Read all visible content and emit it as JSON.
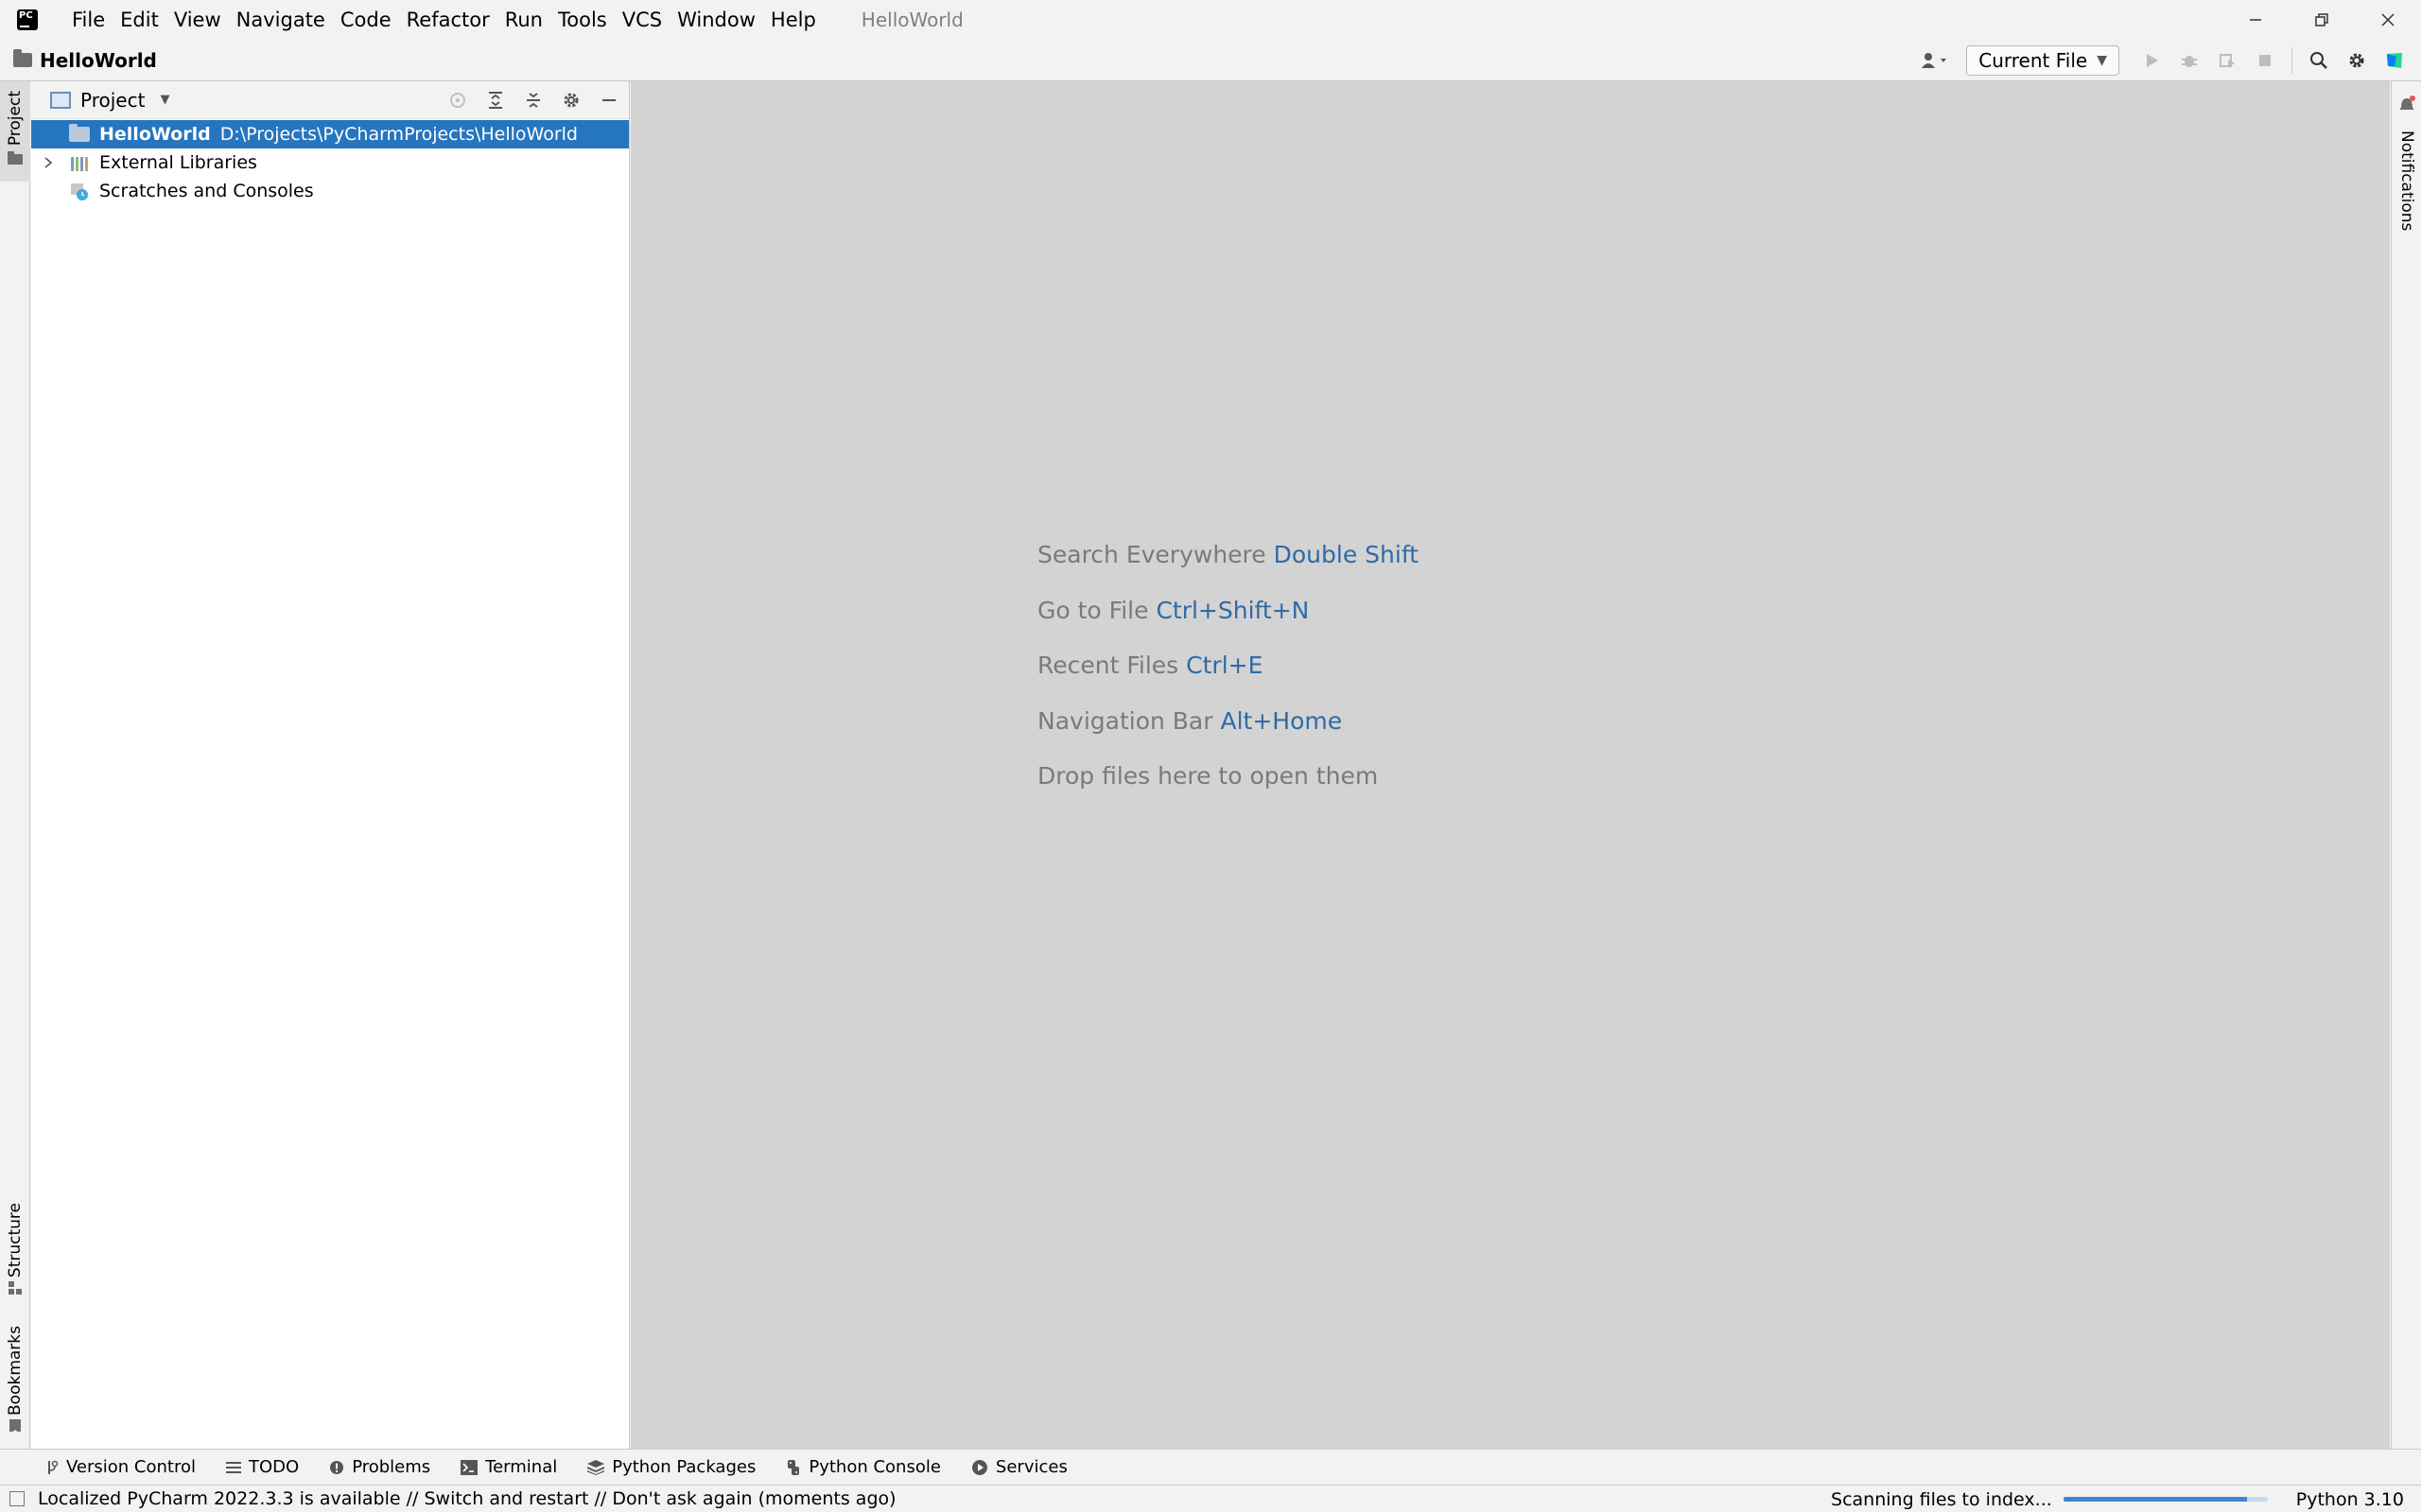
{
  "menu": {
    "items": [
      "File",
      "Edit",
      "View",
      "Navigate",
      "Code",
      "Refactor",
      "Run",
      "Tools",
      "VCS",
      "Window",
      "Help"
    ],
    "window_title": "HelloWorld"
  },
  "navbar": {
    "breadcrumb": "HelloWorld",
    "run_config": "Current File"
  },
  "left_stripe": {
    "project": "Project",
    "structure": "Structure",
    "bookmarks": "Bookmarks"
  },
  "right_stripe": {
    "notifications": "Notifications"
  },
  "project_panel": {
    "title": "Project",
    "tree": [
      {
        "name": "HelloWorld",
        "path": "D:\\Projects\\PyCharmProjects\\HelloWorld",
        "selected": true
      },
      {
        "name": "External Libraries"
      },
      {
        "name": "Scratches and Consoles"
      }
    ]
  },
  "editor_hints": [
    {
      "text": "Search Everywhere",
      "key": "Double Shift"
    },
    {
      "text": "Go to File",
      "key": "Ctrl+Shift+N"
    },
    {
      "text": "Recent Files",
      "key": "Ctrl+E"
    },
    {
      "text": "Navigation Bar",
      "key": "Alt+Home"
    },
    {
      "text": "Drop files here to open them",
      "key": ""
    }
  ],
  "bottom_tools": [
    "Version Control",
    "TODO",
    "Problems",
    "Terminal",
    "Python Packages",
    "Python Console",
    "Services"
  ],
  "status": {
    "message": "Localized PyCharm 2022.3.3 is available // Switch and restart // Don't ask again (moments ago)",
    "indexing": "Scanning files to index...",
    "indexing_progress": 0.9,
    "interpreter": "Python 3.10"
  },
  "colors": {
    "selection": "#2675bf",
    "editor_bg": "#d3d3d3",
    "hint_key": "#2f6aa6"
  }
}
